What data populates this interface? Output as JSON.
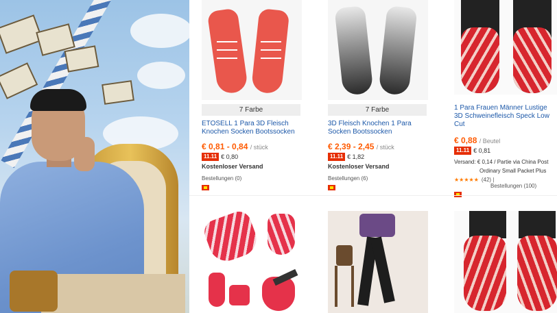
{
  "products": [
    {
      "color_tag": "7 Farbe",
      "title": "ETOSELL 1 Para 3D Fleisch Knochen Socken Bootssocken",
      "price": "€ 0,81 - 0,84",
      "unit": "/ stück",
      "promo_badge": "11.11",
      "promo_price": "€ 0,80",
      "shipping": "Kostenloser Versand",
      "orders": "Bestellungen (0)"
    },
    {
      "color_tag": "7 Farbe",
      "title": "3D Fleisch Knochen 1 Para Socken Bootssocken",
      "price": "€ 2,39 - 2,45",
      "unit": "/ stück",
      "promo_badge": "11.11",
      "promo_price": "€ 1,82",
      "shipping": "Kostenloser Versand",
      "orders": "Bestellungen (6)"
    },
    {
      "title": "1 Para Frauen Männer Lustige 3D Schweinefleisch Speck Low Cut",
      "price": "€ 0,88",
      "unit": "/ Beutel",
      "promo_badge": "11.11",
      "promo_price": "€ 0,81",
      "shipping_detail_1": "Versand:  € 0,14 / Partie via China Post",
      "shipping_detail_2": "Ordinary Small Packet Plus",
      "rating_count": "(42)  |",
      "orders": "Bestellungen (100)"
    }
  ],
  "colors": {
    "price": "#ff5a00",
    "title_link": "#1b57a8",
    "promo_badge": "#e62e04"
  }
}
